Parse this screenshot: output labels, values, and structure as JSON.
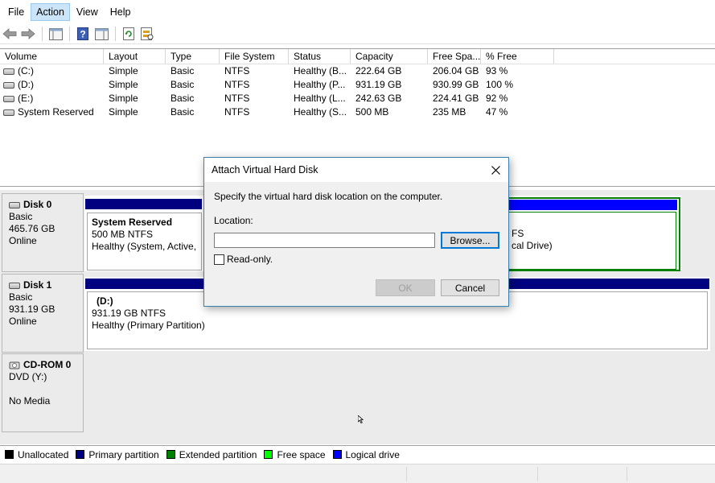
{
  "menu": [
    {
      "label": "File"
    },
    {
      "label": "Action"
    },
    {
      "label": "View"
    },
    {
      "label": "Help"
    }
  ],
  "volume_table": {
    "columns": [
      "Volume",
      "Layout",
      "Type",
      "File System",
      "Status",
      "Capacity",
      "Free Spa...",
      "% Free"
    ],
    "rows": [
      {
        "volume": "(C:)",
        "layout": "Simple",
        "type": "Basic",
        "fs": "NTFS",
        "status": "Healthy (B...",
        "capacity": "222.64 GB",
        "free": "206.04 GB",
        "pct": "93 %"
      },
      {
        "volume": "(D:)",
        "layout": "Simple",
        "type": "Basic",
        "fs": "NTFS",
        "status": "Healthy (P...",
        "capacity": "931.19 GB",
        "free": "930.99 GB",
        "pct": "100 %"
      },
      {
        "volume": "(E:)",
        "layout": "Simple",
        "type": "Basic",
        "fs": "NTFS",
        "status": "Healthy (L...",
        "capacity": "242.63 GB",
        "free": "224.41 GB",
        "pct": "92 %"
      },
      {
        "volume": "System Reserved",
        "layout": "Simple",
        "type": "Basic",
        "fs": "NTFS",
        "status": "Healthy (S...",
        "capacity": "500 MB",
        "free": "235 MB",
        "pct": "47 %"
      }
    ]
  },
  "disks": [
    {
      "name": "Disk 0",
      "type": "Basic",
      "size": "465.76 GB",
      "state": "Online",
      "partitions": [
        {
          "title": "System Reserved",
          "line1": "500 MB NTFS",
          "line2": "Healthy (System, Active,"
        },
        {
          "title": "",
          "line1": "FS",
          "line2": "cal Drive)"
        }
      ]
    },
    {
      "name": "Disk 1",
      "type": "Basic",
      "size": "931.19 GB",
      "state": "Online",
      "partitions": [
        {
          "title": "(D:)",
          "line1": "931.19 GB NTFS",
          "line2": "Healthy (Primary Partition)"
        }
      ]
    },
    {
      "name": "CD-ROM 0",
      "type": "DVD (Y:)",
      "size": "",
      "state": "No Media"
    }
  ],
  "legend": [
    {
      "label": "Unallocated",
      "color": "#000000"
    },
    {
      "label": "Primary partition",
      "color": "#000080"
    },
    {
      "label": "Extended partition",
      "color": "#008000"
    },
    {
      "label": "Free space",
      "color": "#00ff00"
    },
    {
      "label": "Logical drive",
      "color": "#0000ff"
    }
  ],
  "dialog": {
    "title": "Attach Virtual Hard Disk",
    "instruction": "Specify the virtual hard disk location on the computer.",
    "location_label": "Location:",
    "location_value": "",
    "browse_label": "Browse...",
    "readonly_label": "Read-only.",
    "readonly_checked": false,
    "ok_label": "OK",
    "cancel_label": "Cancel"
  },
  "colors": {
    "primary_partition": "#000080",
    "extended_partition": "#008000",
    "logical_drive": "#0000ff",
    "menu_highlight": "#cce4f7"
  }
}
